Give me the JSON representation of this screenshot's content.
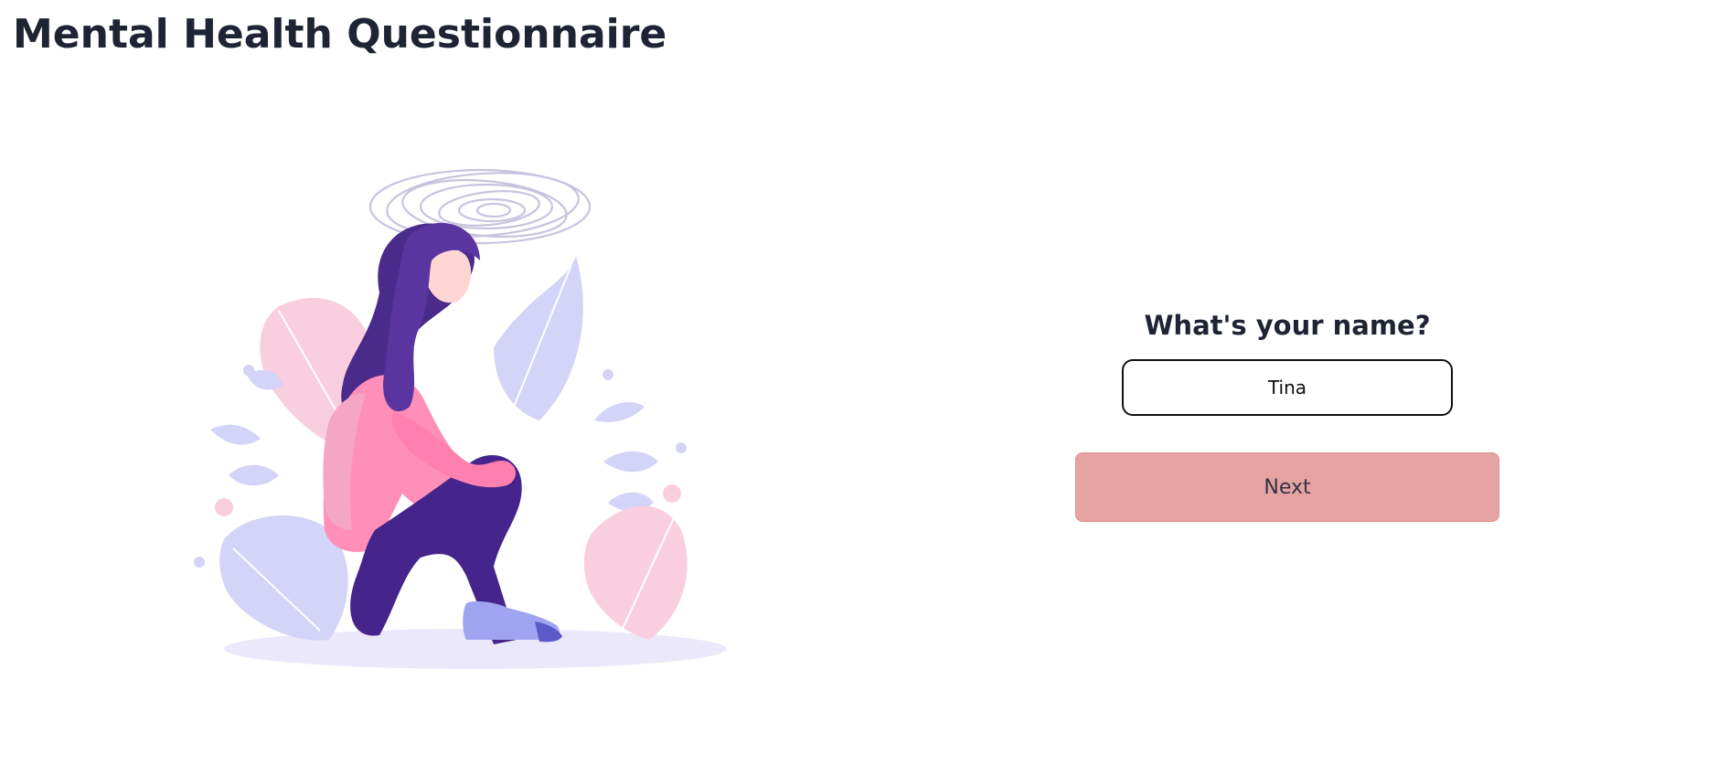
{
  "header": {
    "title": "Mental Health Questionnaire"
  },
  "illustration": {
    "icon": "sad-woman-sitting-illustration"
  },
  "form": {
    "question": "What's your name?",
    "name_value": "Tina",
    "next_label": "Next"
  },
  "colors": {
    "title_text": "#1e2433",
    "button_bg": "#e5a3a2",
    "input_border": "#111111"
  }
}
